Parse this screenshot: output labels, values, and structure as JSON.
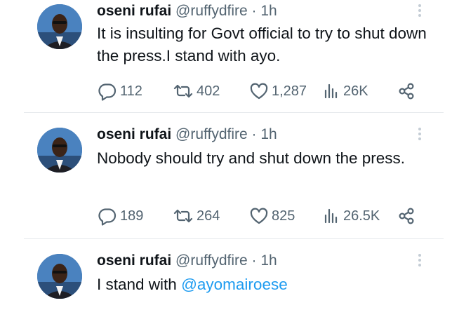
{
  "tweets": [
    {
      "name": "oseni rufai",
      "handle": "@ruffydfire",
      "sep": "·",
      "time": "1h",
      "text": "It is insulting for Govt official to try to shut down the press.I stand with ayo.",
      "replies": "112",
      "retweets": "402",
      "likes": "1,287",
      "views": "26K"
    },
    {
      "name": "oseni rufai",
      "handle": "@ruffydfire",
      "sep": "·",
      "time": "1h",
      "text": "Nobody should try and shut down the press.",
      "replies": "189",
      "retweets": "264",
      "likes": "825",
      "views": "26.5K"
    },
    {
      "name": "oseni rufai",
      "handle": "@ruffydfire",
      "sep": "·",
      "time": "1h",
      "text_prefix": "I stand with ",
      "mention": "@ayomairoese"
    }
  ],
  "icons": {
    "reply": "reply-icon",
    "retweet": "retweet-icon",
    "like": "heart-icon",
    "views": "views-icon",
    "share": "share-icon",
    "more": "more-icon"
  },
  "colors": {
    "text": "#0f1419",
    "muted": "#536471",
    "link": "#1d9bf0",
    "divider": "#e6e9ec"
  }
}
